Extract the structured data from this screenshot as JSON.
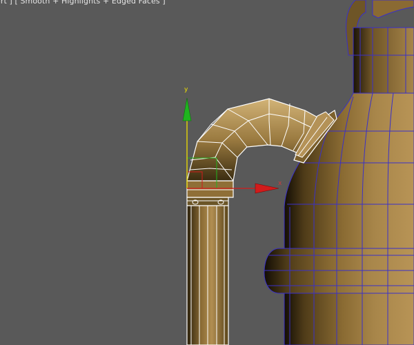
{
  "viewport": {
    "label": "ort ] [ Smooth + Highlights + Edged Faces ]",
    "axes": {
      "y": "y",
      "x": "x"
    },
    "colors": {
      "background": "#595959",
      "mesh_shadow": "#140f05",
      "mesh_mid": "#6b5527",
      "mesh_light": "#c8a56a",
      "wire_selected": "#ffffff",
      "wire_object": "#3a30c8",
      "axis_y": "#1fb51f",
      "axis_x": "#d21b1b",
      "axis_y_label": "#f0e000"
    },
    "objects": [
      "pipe-selected",
      "jug-vessel"
    ]
  }
}
